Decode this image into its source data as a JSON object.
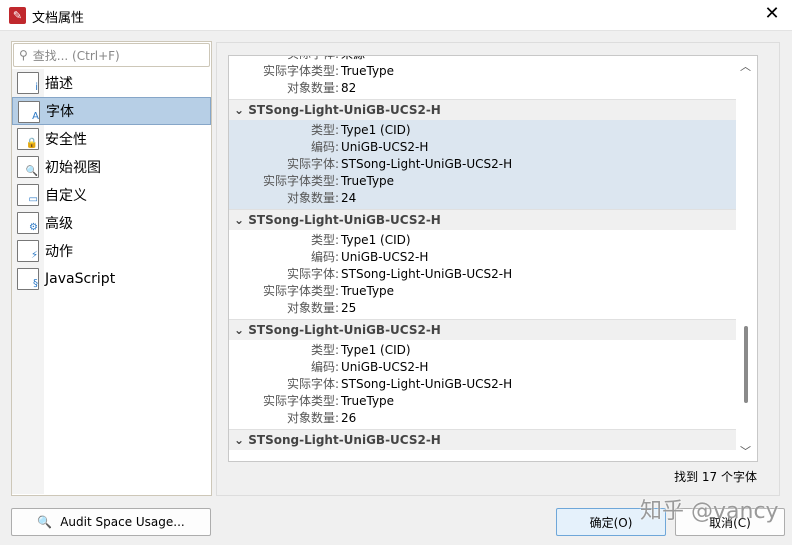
{
  "window": {
    "title": "文档属性",
    "close": "✕"
  },
  "search": {
    "placeholder": "查找... (Ctrl+F)",
    "icon": "search-icon"
  },
  "sidebar": {
    "items": [
      {
        "label": "描述",
        "icon": "info-icon",
        "badge": "i"
      },
      {
        "label": "字体",
        "icon": "font-icon",
        "badge": "A",
        "selected": true
      },
      {
        "label": "安全性",
        "icon": "lock-icon",
        "badge": "🔒"
      },
      {
        "label": "初始视图",
        "icon": "magnifier-icon",
        "badge": "🔍"
      },
      {
        "label": "自定义",
        "icon": "custom-icon",
        "badge": "▭"
      },
      {
        "label": "高级",
        "icon": "gear-icon",
        "badge": "⚙"
      },
      {
        "label": "动作",
        "icon": "lightning-icon",
        "badge": "⚡"
      },
      {
        "label": "JavaScript",
        "icon": "script-icon",
        "badge": "§"
      }
    ]
  },
  "fonts": {
    "top_partial": [
      {
        "k": "实际字体",
        "v": "来源"
      },
      {
        "k": "实际字体类型",
        "v": "TrueType"
      },
      {
        "k": "对象数量",
        "v": "82"
      }
    ],
    "groups": [
      {
        "name": "STSong-Light-UniGB-UCS2-H",
        "selected": true,
        "rows": [
          {
            "k": "类型",
            "v": "Type1 (CID)"
          },
          {
            "k": "编码",
            "v": "UniGB-UCS2-H"
          },
          {
            "k": "实际字体",
            "v": "STSong-Light-UniGB-UCS2-H"
          },
          {
            "k": "实际字体类型",
            "v": "TrueType"
          },
          {
            "k": "对象数量",
            "v": "24"
          }
        ]
      },
      {
        "name": "STSong-Light-UniGB-UCS2-H",
        "rows": [
          {
            "k": "类型",
            "v": "Type1 (CID)"
          },
          {
            "k": "编码",
            "v": "UniGB-UCS2-H"
          },
          {
            "k": "实际字体",
            "v": "STSong-Light-UniGB-UCS2-H"
          },
          {
            "k": "实际字体类型",
            "v": "TrueType"
          },
          {
            "k": "对象数量",
            "v": "25"
          }
        ]
      },
      {
        "name": "STSong-Light-UniGB-UCS2-H",
        "rows": [
          {
            "k": "类型",
            "v": "Type1 (CID)"
          },
          {
            "k": "编码",
            "v": "UniGB-UCS2-H"
          },
          {
            "k": "实际字体",
            "v": "STSong-Light-UniGB-UCS2-H"
          },
          {
            "k": "实际字体类型",
            "v": "TrueType"
          },
          {
            "k": "对象数量",
            "v": "26"
          }
        ]
      },
      {
        "name": "STSong-Light-UniGB-UCS2-H",
        "rows": []
      }
    ]
  },
  "status": "找到 17 个字体",
  "buttons": {
    "audit": "Audit Space Usage...",
    "ok": "确定(O)",
    "cancel": "取消(C)"
  },
  "watermark": "知乎 @vancy"
}
